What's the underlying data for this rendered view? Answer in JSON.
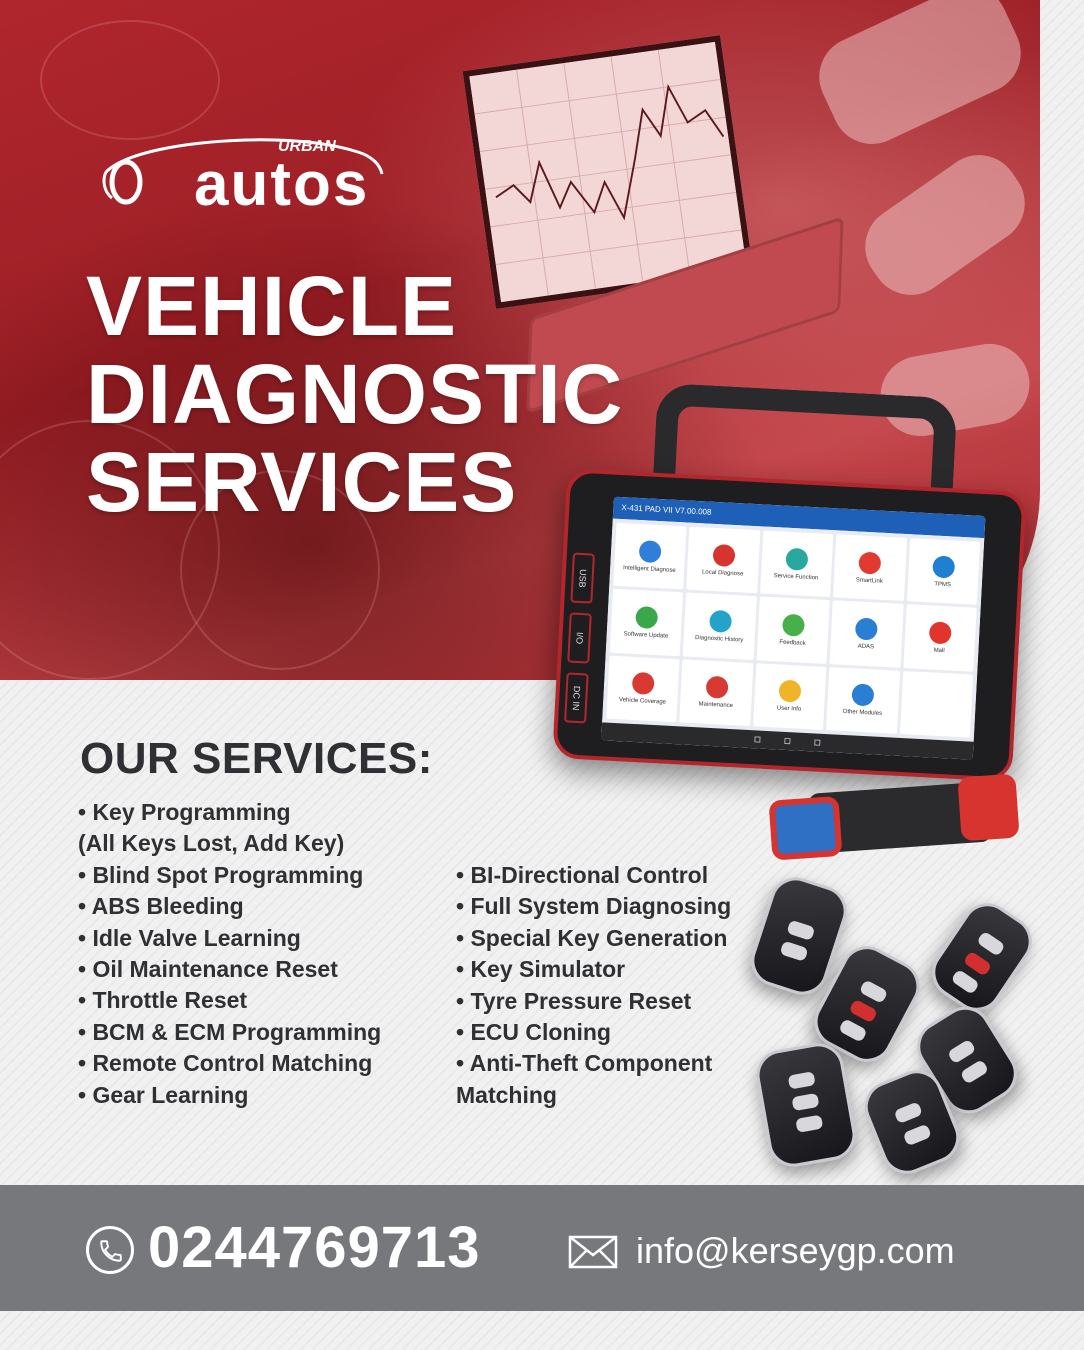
{
  "brand": {
    "logo_small": "URBAN",
    "logo_large": "autos"
  },
  "headline": {
    "line1": "VEHICLE",
    "line2": "DIAGNOSTIC",
    "line3": "SERVICES"
  },
  "tablet": {
    "status_bar": "X-431 PAD VII V7.00.008",
    "ports": [
      "USB",
      "I/O",
      "DC IN"
    ],
    "apps": [
      "Intelligent Diagnose",
      "Local Diagnose",
      "Service Function",
      "SmartLink",
      "TPMS",
      "Software Update",
      "Diagnostic History",
      "Feedback",
      "ADAS",
      "Mall",
      "Vehicle Coverage",
      "Maintenance",
      "User Info",
      "Other Modules",
      ""
    ]
  },
  "services": {
    "title": "OUR SERVICES:",
    "left": [
      "• Key Programming",
      "(All Keys Lost, Add Key)",
      "• Blind Spot Programming",
      "• ABS Bleeding",
      "• Idle Valve Learning",
      "• Oil Maintenance Reset",
      "• Throttle Reset",
      "• BCM & ECM Programming",
      "• Remote Control Matching",
      "• Gear Learning"
    ],
    "right": [
      "• BI-Directional Control",
      "• Full System Diagnosing",
      "• Special Key Generation",
      "• Key Simulator",
      "• Tyre Pressure Reset",
      "• ECU Cloning",
      "• Anti-Theft Component",
      "Matching"
    ]
  },
  "contact": {
    "phone": "0244769713",
    "email": "info@kerseygp.com"
  },
  "colors": {
    "hero_red": "#a9272e",
    "footer_gray": "#77787c",
    "text_dark": "#2f3033",
    "accent_red": "#d8342f"
  },
  "icons": [
    "phone-icon",
    "mail-icon",
    "car-outline-logo-icon"
  ]
}
